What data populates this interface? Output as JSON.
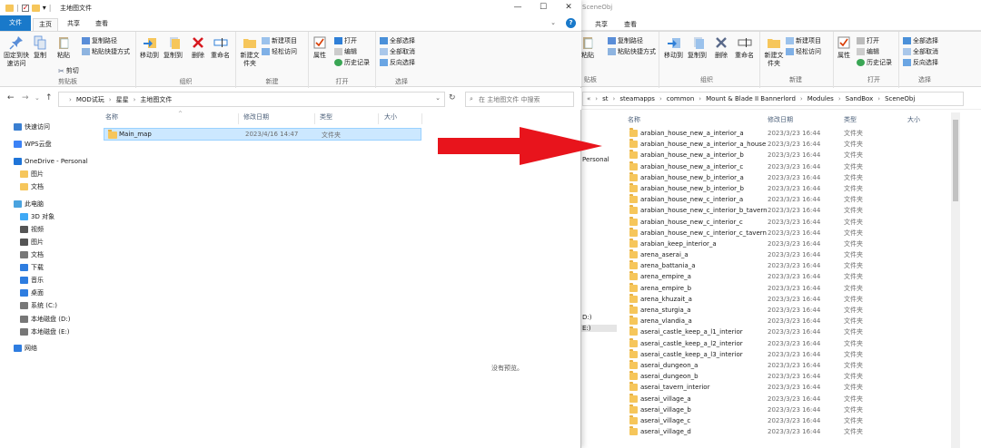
{
  "front": {
    "window_title": "主地图文件",
    "tabs": [
      {
        "label": "文件",
        "state": "file"
      },
      {
        "label": "主页",
        "state": "active"
      },
      {
        "label": "共享",
        "state": "normal"
      },
      {
        "label": "查看",
        "state": "normal"
      }
    ],
    "ribbon": {
      "clipboard": {
        "pin_label": "固定到快速访问",
        "copy_label": "复制",
        "paste_label": "粘贴",
        "copy_path_label": "复制路径",
        "paste_shortcut_label": "粘贴快捷方式",
        "cut_label": "剪切",
        "group_label": "剪贴板"
      },
      "organize": {
        "move_to_label": "移动到",
        "copy_to_label": "复制到",
        "delete_label": "删除",
        "rename_label": "重命名",
        "group_label": "组织"
      },
      "new": {
        "new_folder_label": "新建文件夹",
        "new_item_label": "新建项目",
        "easy_access_label": "轻松访问",
        "group_label": "新建"
      },
      "open": {
        "properties_label": "属性",
        "open_label": "打开",
        "edit_label": "编辑",
        "history_label": "历史记录",
        "group_label": "打开"
      },
      "select": {
        "select_all_label": "全部选择",
        "select_none_label": "全部取消",
        "invert_label": "反向选择",
        "group_label": "选择"
      }
    },
    "address": {
      "crumbs": [
        "MOD试玩",
        "星星",
        "主地图文件"
      ],
      "search_placeholder": "在 主地图文件 中搜索"
    },
    "nav": [
      {
        "label": "快速访问",
        "icon": "pin-icon",
        "color": "#3a7fd1",
        "indent": 0
      },
      {
        "label": "WPS云盘",
        "icon": "cloud-icon",
        "color": "#3b82f6",
        "indent": 0
      },
      {
        "label": "OneDrive - Personal",
        "icon": "onedrive-icon",
        "color": "#1e74d8",
        "indent": 0
      },
      {
        "label": "图片",
        "icon": "folder-icon",
        "color": "#f6c65b",
        "indent": 1
      },
      {
        "label": "文档",
        "icon": "folder-icon",
        "color": "#f6c65b",
        "indent": 1
      },
      {
        "label": "此电脑",
        "icon": "computer-icon",
        "color": "#4aa3df",
        "indent": 0
      },
      {
        "label": "3D 对象",
        "icon": "3d-objects-icon",
        "color": "#3fa9f5",
        "indent": 1
      },
      {
        "label": "视频",
        "icon": "video-icon",
        "color": "#555555",
        "indent": 1
      },
      {
        "label": "图片",
        "icon": "pictures-icon",
        "color": "#555555",
        "indent": 1
      },
      {
        "label": "文档",
        "icon": "documents-icon",
        "color": "#777777",
        "indent": 1
      },
      {
        "label": "下载",
        "icon": "download-icon",
        "color": "#2e7de0",
        "indent": 1
      },
      {
        "label": "音乐",
        "icon": "music-icon",
        "color": "#2e7de0",
        "indent": 1
      },
      {
        "label": "桌面",
        "icon": "desktop-icon",
        "color": "#2e7de0",
        "indent": 1
      },
      {
        "label": "系统 (C:)",
        "icon": "drive-icon",
        "color": "#777777",
        "indent": 1
      },
      {
        "label": "本地磁盘 (D:)",
        "icon": "drive-icon",
        "color": "#777777",
        "indent": 1
      },
      {
        "label": "本地磁盘 (E:)",
        "icon": "drive-icon",
        "color": "#777777",
        "indent": 1
      },
      {
        "label": "网络",
        "icon": "network-icon",
        "color": "#2e7de0",
        "indent": 0
      }
    ],
    "columns": [
      "名称",
      "修改日期",
      "类型",
      "大小"
    ],
    "files": [
      {
        "name": "Main_map",
        "date": "2023/4/16 14:47",
        "type": "文件夹",
        "size": ""
      }
    ],
    "preview_message": "没有预览。"
  },
  "back": {
    "window_title": "SceneObj",
    "tabs": [
      "共享",
      "查看"
    ],
    "ribbon": {
      "copy_path_label": "复制路径",
      "paste_shortcut_label": "粘贴快捷方式",
      "paste_label": "粘贴",
      "move_to_label": "移动到",
      "copy_to_label": "复制到",
      "delete_label": "删除",
      "rename_label": "重命名",
      "new_folder_label": "新建文件夹",
      "new_item_label": "新建项目",
      "easy_access_label": "轻松访问",
      "properties_label": "属性",
      "open_label": "打开",
      "edit_label": "编辑",
      "history_label": "历史记录",
      "select_all_label": "全部选择",
      "select_none_label": "全部取消",
      "invert_label": "反向选择",
      "group_clipboard": "贴板",
      "group_organize": "组织",
      "group_new": "新建",
      "group_open": "打开",
      "group_select": "选择"
    },
    "address": {
      "prefix": "«",
      "crumbs": [
        "st",
        "steamapps",
        "common",
        "Mount & Blade II Bannerlord",
        "Modules",
        "SandBox",
        "SceneObj"
      ]
    },
    "nav_fragments": [
      "Personal",
      "D:)",
      "E:)"
    ],
    "columns": [
      "名称",
      "修改日期",
      "类型",
      "大小"
    ],
    "files": [
      {
        "name": "arabian_house_new_a_interior_a",
        "date": "2023/3/23 16:44",
        "type": "文件夹"
      },
      {
        "name": "arabian_house_new_a_interior_a_house",
        "date": "2023/3/23 16:44",
        "type": "文件夹"
      },
      {
        "name": "arabian_house_new_a_interior_b",
        "date": "2023/3/23 16:44",
        "type": "文件夹"
      },
      {
        "name": "arabian_house_new_a_interior_c",
        "date": "2023/3/23 16:44",
        "type": "文件夹"
      },
      {
        "name": "arabian_house_new_b_interior_a",
        "date": "2023/3/23 16:44",
        "type": "文件夹"
      },
      {
        "name": "arabian_house_new_b_interior_b",
        "date": "2023/3/23 16:44",
        "type": "文件夹"
      },
      {
        "name": "arabian_house_new_c_interior_a",
        "date": "2023/3/23 16:44",
        "type": "文件夹"
      },
      {
        "name": "arabian_house_new_c_interior_b_tavern",
        "date": "2023/3/23 16:44",
        "type": "文件夹"
      },
      {
        "name": "arabian_house_new_c_interior_c",
        "date": "2023/3/23 16:44",
        "type": "文件夹"
      },
      {
        "name": "arabian_house_new_c_interior_c_tavern",
        "date": "2023/3/23 16:44",
        "type": "文件夹"
      },
      {
        "name": "arabian_keep_interior_a",
        "date": "2023/3/23 16:44",
        "type": "文件夹"
      },
      {
        "name": "arena_aserai_a",
        "date": "2023/3/23 16:44",
        "type": "文件夹"
      },
      {
        "name": "arena_battania_a",
        "date": "2023/3/23 16:44",
        "type": "文件夹"
      },
      {
        "name": "arena_empire_a",
        "date": "2023/3/23 16:44",
        "type": "文件夹"
      },
      {
        "name": "arena_empire_b",
        "date": "2023/3/23 16:44",
        "type": "文件夹"
      },
      {
        "name": "arena_khuzait_a",
        "date": "2023/3/23 16:44",
        "type": "文件夹"
      },
      {
        "name": "arena_sturgia_a",
        "date": "2023/3/23 16:44",
        "type": "文件夹"
      },
      {
        "name": "arena_vlandia_a",
        "date": "2023/3/23 16:44",
        "type": "文件夹"
      },
      {
        "name": "aserai_castle_keep_a_l1_interior",
        "date": "2023/3/23 16:44",
        "type": "文件夹"
      },
      {
        "name": "aserai_castle_keep_a_l2_interior",
        "date": "2023/3/23 16:44",
        "type": "文件夹"
      },
      {
        "name": "aserai_castle_keep_a_l3_interior",
        "date": "2023/3/23 16:44",
        "type": "文件夹"
      },
      {
        "name": "aserai_dungeon_a",
        "date": "2023/3/23 16:44",
        "type": "文件夹"
      },
      {
        "name": "aserai_dungeon_b",
        "date": "2023/3/23 16:44",
        "type": "文件夹"
      },
      {
        "name": "aserai_tavern_interior",
        "date": "2023/3/23 16:44",
        "type": "文件夹"
      },
      {
        "name": "aserai_village_a",
        "date": "2023/3/23 16:44",
        "type": "文件夹"
      },
      {
        "name": "aserai_village_b",
        "date": "2023/3/23 16:44",
        "type": "文件夹"
      },
      {
        "name": "aserai_village_c",
        "date": "2023/3/23 16:44",
        "type": "文件夹"
      },
      {
        "name": "aserai_village_d",
        "date": "2023/3/23 16:44",
        "type": "文件夹"
      }
    ]
  },
  "colors": {
    "accent": "#1979ca",
    "selection_bg": "#cce8ff",
    "selection_border": "#99d1ff",
    "folder": "#f6c65b",
    "arrow": "#e8141c",
    "header_text": "#4c607a"
  },
  "icons": {
    "minimize": "—",
    "maximize": "☐",
    "close": "✕",
    "back": "←",
    "forward": "→",
    "dropdown": "⌄",
    "up": "↑",
    "refresh": "↻",
    "search": "⌕",
    "help": "?",
    "ribbon_toggle": "⌄",
    "chevron": "›",
    "quick_access_dropdown": "▾"
  }
}
